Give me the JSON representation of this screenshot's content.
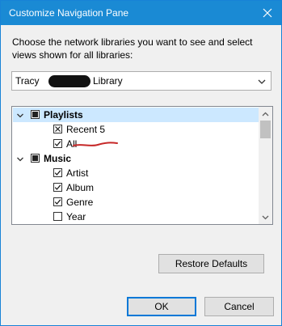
{
  "window": {
    "title": "Customize Navigation Pane"
  },
  "intro_text": "Choose the network libraries you want to see and select views shown for all libraries:",
  "library_select": {
    "value_prefix": "Tracy",
    "value_suffix": "Library"
  },
  "tree": {
    "items": [
      {
        "label": "Playlists",
        "level": 0,
        "state": "indeterminate",
        "expanded": true,
        "selected": true
      },
      {
        "label": "Recent 5",
        "level": 1,
        "state": "excluded"
      },
      {
        "label": "All",
        "level": 1,
        "state": "checked"
      },
      {
        "label": "Music",
        "level": 0,
        "state": "indeterminate",
        "expanded": true
      },
      {
        "label": "Artist",
        "level": 1,
        "state": "checked"
      },
      {
        "label": "Album",
        "level": 1,
        "state": "checked"
      },
      {
        "label": "Genre",
        "level": 1,
        "state": "checked"
      },
      {
        "label": "Year",
        "level": 1,
        "state": "unchecked"
      }
    ]
  },
  "buttons": {
    "restore_defaults": "Restore Defaults",
    "ok": "OK",
    "cancel": "Cancel"
  },
  "icons": {
    "close": "close-icon",
    "dropdown": "chevron-down-icon",
    "expand": "chevron-down-icon",
    "scroll_up": "chevron-up-icon",
    "scroll_down": "chevron-down-icon"
  },
  "colors": {
    "titlebar": "#1a8ad4",
    "selected_row": "#cce8ff",
    "default_button_border": "#0078d7",
    "annotation": "#c62828"
  }
}
